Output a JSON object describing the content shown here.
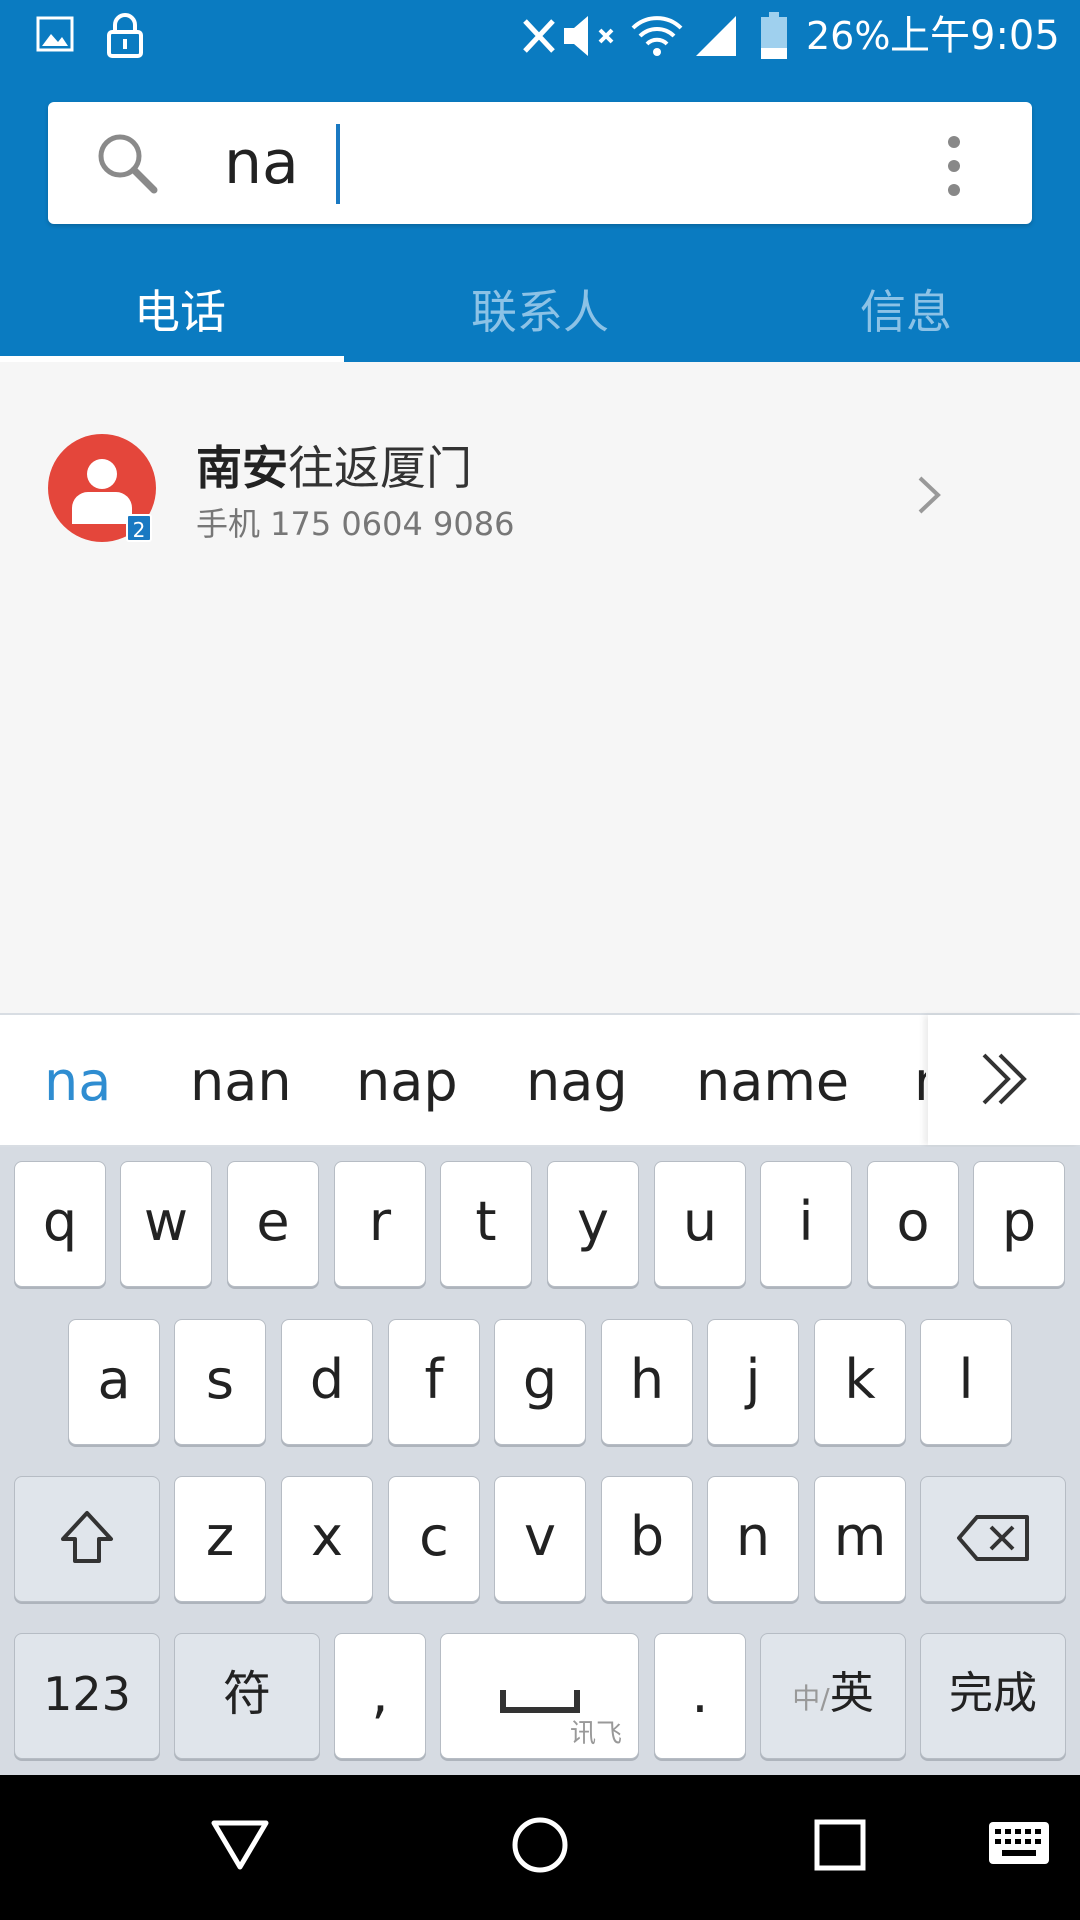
{
  "status_bar": {
    "battery": "26%",
    "time": "上午9:05"
  },
  "search": {
    "value": "na"
  },
  "tabs": [
    {
      "label": "电话",
      "active": true
    },
    {
      "label": "联系人",
      "active": false
    },
    {
      "label": "信息",
      "active": false
    }
  ],
  "result": {
    "name_bold": "南安",
    "name_rest": "往返厦门",
    "number": "手机 175 0604 9086",
    "sim_badge": "2"
  },
  "suggestions": [
    "na",
    "nan",
    "nap",
    "nag",
    "name",
    "n"
  ],
  "keyboard": {
    "row1": [
      "q",
      "w",
      "e",
      "r",
      "t",
      "y",
      "u",
      "i",
      "o",
      "p"
    ],
    "row2": [
      "a",
      "s",
      "d",
      "f",
      "g",
      "h",
      "j",
      "k",
      "l"
    ],
    "row3": [
      "z",
      "x",
      "c",
      "v",
      "b",
      "n",
      "m"
    ],
    "num_key": "123",
    "symbol_key": "符",
    "comma_key": ",",
    "space_brand": "讯飞",
    "period_key": ".",
    "lang_key_dim": "中/",
    "lang_key": "英",
    "done_key": "完成"
  },
  "colors": {
    "header": "#0a7bc1",
    "accent": "#2f8dd1",
    "avatar": "#e4463b"
  }
}
